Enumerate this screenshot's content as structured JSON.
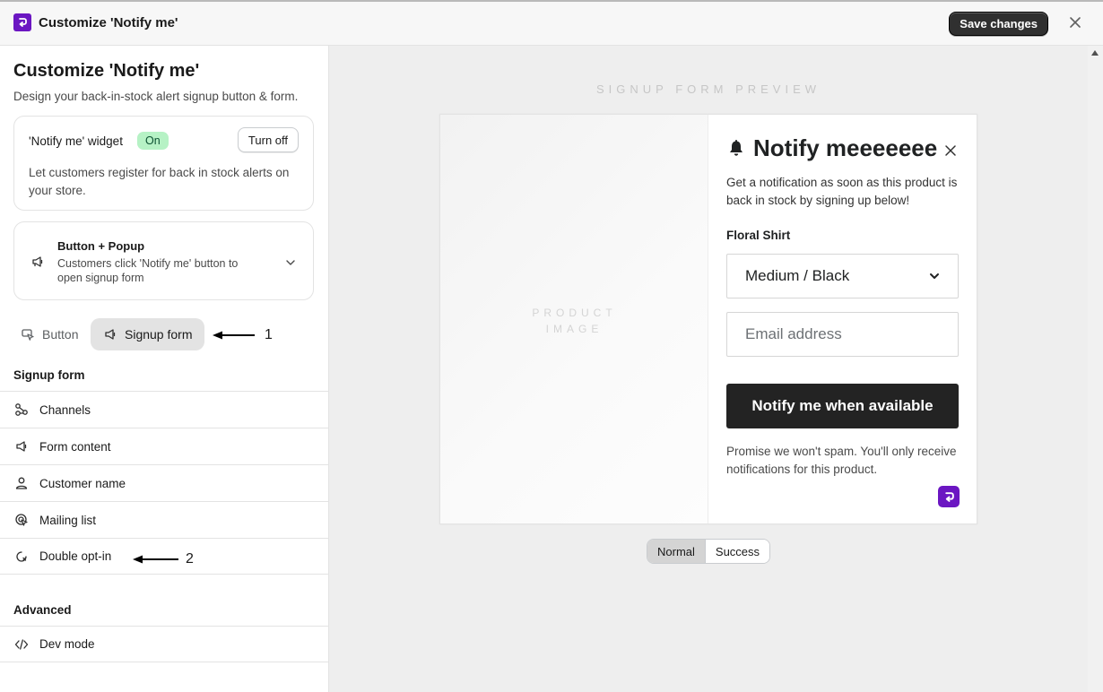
{
  "header": {
    "title": "Customize 'Notify me'",
    "save_label": "Save changes",
    "close_icon": "close-icon"
  },
  "sidebar": {
    "title": "Customize 'Notify me'",
    "subtitle": "Design your back-in-stock alert signup button & form.",
    "widget_card": {
      "label": "'Notify me' widget",
      "status": "On",
      "toggle_label": "Turn off",
      "description": "Let customers register for back in stock alerts on your store."
    },
    "mode_card": {
      "title": "Button + Popup",
      "description": "Customers click 'Notify me' button to open signup form"
    },
    "tabs": [
      {
        "label": "Button",
        "icon": "cursor-click-icon"
      },
      {
        "label": "Signup form",
        "icon": "megaphone-icon",
        "selected": true
      }
    ],
    "annotations": {
      "first": "1",
      "second": "2"
    },
    "signup_section": {
      "title": "Signup form",
      "items": [
        {
          "label": "Channels",
          "icon": "channels-icon"
        },
        {
          "label": "Form content",
          "icon": "megaphone-icon"
        },
        {
          "label": "Customer name",
          "icon": "person-icon"
        },
        {
          "label": "Mailing list",
          "icon": "target-icon"
        },
        {
          "label": "Double opt-in",
          "icon": "refresh-icon"
        }
      ]
    },
    "advanced_section": {
      "title": "Advanced",
      "items": [
        {
          "label": "Dev mode",
          "icon": "code-icon"
        }
      ]
    }
  },
  "preview": {
    "label": "SIGNUP FORM PREVIEW",
    "image_placeholder_line1": "PRODUCT",
    "image_placeholder_line2": "IMAGE",
    "form": {
      "title": "Notify meeeeeee",
      "description": "Get a notification as soon as this product is back in stock by signing up below!",
      "product_name": "Floral Shirt",
      "variant_value": "Medium / Black",
      "email_placeholder": "Email address",
      "submit_label": "Notify me when available",
      "spam_note": "Promise we won't spam. You'll only receive notifications for this product."
    },
    "state_toggle": [
      {
        "label": "Normal",
        "selected": true
      },
      {
        "label": "Success",
        "selected": false
      }
    ]
  },
  "colors": {
    "brand": "#6b16c2",
    "primary_button": "#303030",
    "badge_on_bg": "#b6f2c5",
    "preview_bg": "#eeeeee"
  }
}
